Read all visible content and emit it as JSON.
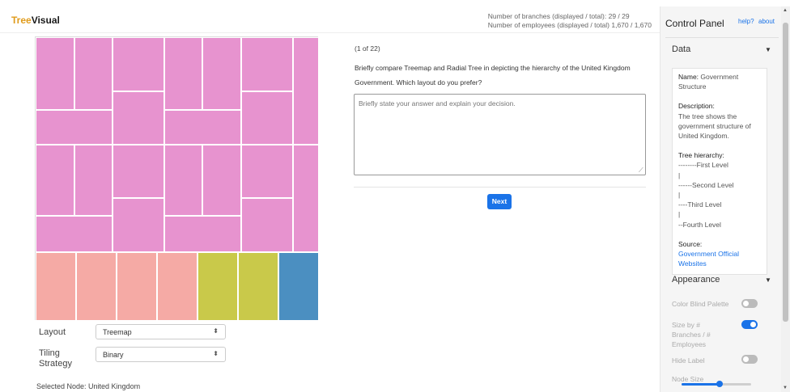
{
  "header": {
    "brand_prefix": "Tree",
    "brand_suffix": "Visual",
    "branches_stat": "Number of branches (displayed / total): 29 / 29",
    "employees_stat": "Number of employees (displayed / total) 1,670 / 1,670"
  },
  "treemap": {
    "colors": {
      "pink": "#e793cf",
      "salmon": "#f5aaa5",
      "olive": "#c9c94a",
      "blue": "#4b8fc1"
    }
  },
  "controls": {
    "layout_label": "Layout",
    "layout_value": "Treemap",
    "tiling_label": "Tiling Strategy",
    "tiling_value": "Binary",
    "selected_node": "Selected Node: United Kingdom"
  },
  "question": {
    "count": "(1 of 22)",
    "text": "Briefly compare Treemap and Radial Tree in depicting the hierarchy of the United Kingdom Government. Which layout do you prefer?",
    "placeholder": "Briefly state your answer and explain your decision.",
    "next_label": "Next"
  },
  "panel": {
    "title": "Control Panel",
    "help": "help?",
    "about": "about",
    "data_section": "Data",
    "name_key": "Name:",
    "name_value": "Government Structure",
    "description_key": "Description:",
    "description_value": "The tree shows the government structure of United Kingdom.",
    "hierarchy_key": "Tree hierarchy:",
    "hierarchy_lines": [
      "--------First Level",
      "|",
      "------Second Level",
      "|",
      "----Third Level",
      "|",
      "--Fourth Level"
    ],
    "source_key": "Source:",
    "source_value": "Government Official Websites",
    "appearance_section": "Appearance",
    "color_blind_label": "Color Blind Palette",
    "color_blind_on": false,
    "size_by_label": "Size by # Branches / # Employees",
    "size_by_on": true,
    "hide_label_label": "Hide Label",
    "hide_label_on": false,
    "node_size_label": "Node Size",
    "node_size_level": 0.55
  }
}
